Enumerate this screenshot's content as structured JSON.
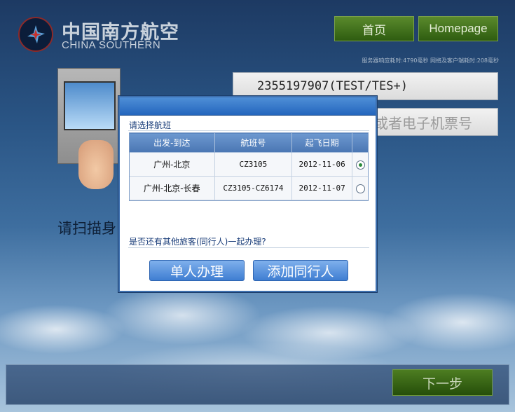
{
  "header": {
    "logo_cn": "中国南方航空",
    "logo_en": "CHINA SOUTHERN",
    "home_cn": "首页",
    "home_en": "Homepage",
    "timing": "服务器响应耗时:4790毫秒    网络及客户端耗时:208毫秒"
  },
  "form": {
    "passport_value": "2355197907(TEST/TES+)",
    "ticket_placeholder": "或者电子机票号",
    "scan_hint": "请扫描身"
  },
  "dialog": {
    "prompt": "请选择航班",
    "columns": [
      "出发-到达",
      "航班号",
      "起飞日期"
    ],
    "rows": [
      {
        "route": "广州-北京",
        "flight": "CZ3105",
        "date": "2012-11-06",
        "selected": true
      },
      {
        "route": "广州-北京-长春",
        "flight": "CZ3105-CZ6174",
        "date": "2012-11-07",
        "selected": false
      }
    ],
    "companion_question": "是否还有其他旅客(同行人)一起办理?",
    "single_button": "单人办理",
    "add_companion_button": "添加同行人"
  },
  "footer": {
    "next_button": "下一步"
  },
  "colors": {
    "dialog_header": "#2466bd",
    "green_button": "#2e5c10",
    "selected_radio": "#2a8a3a"
  }
}
